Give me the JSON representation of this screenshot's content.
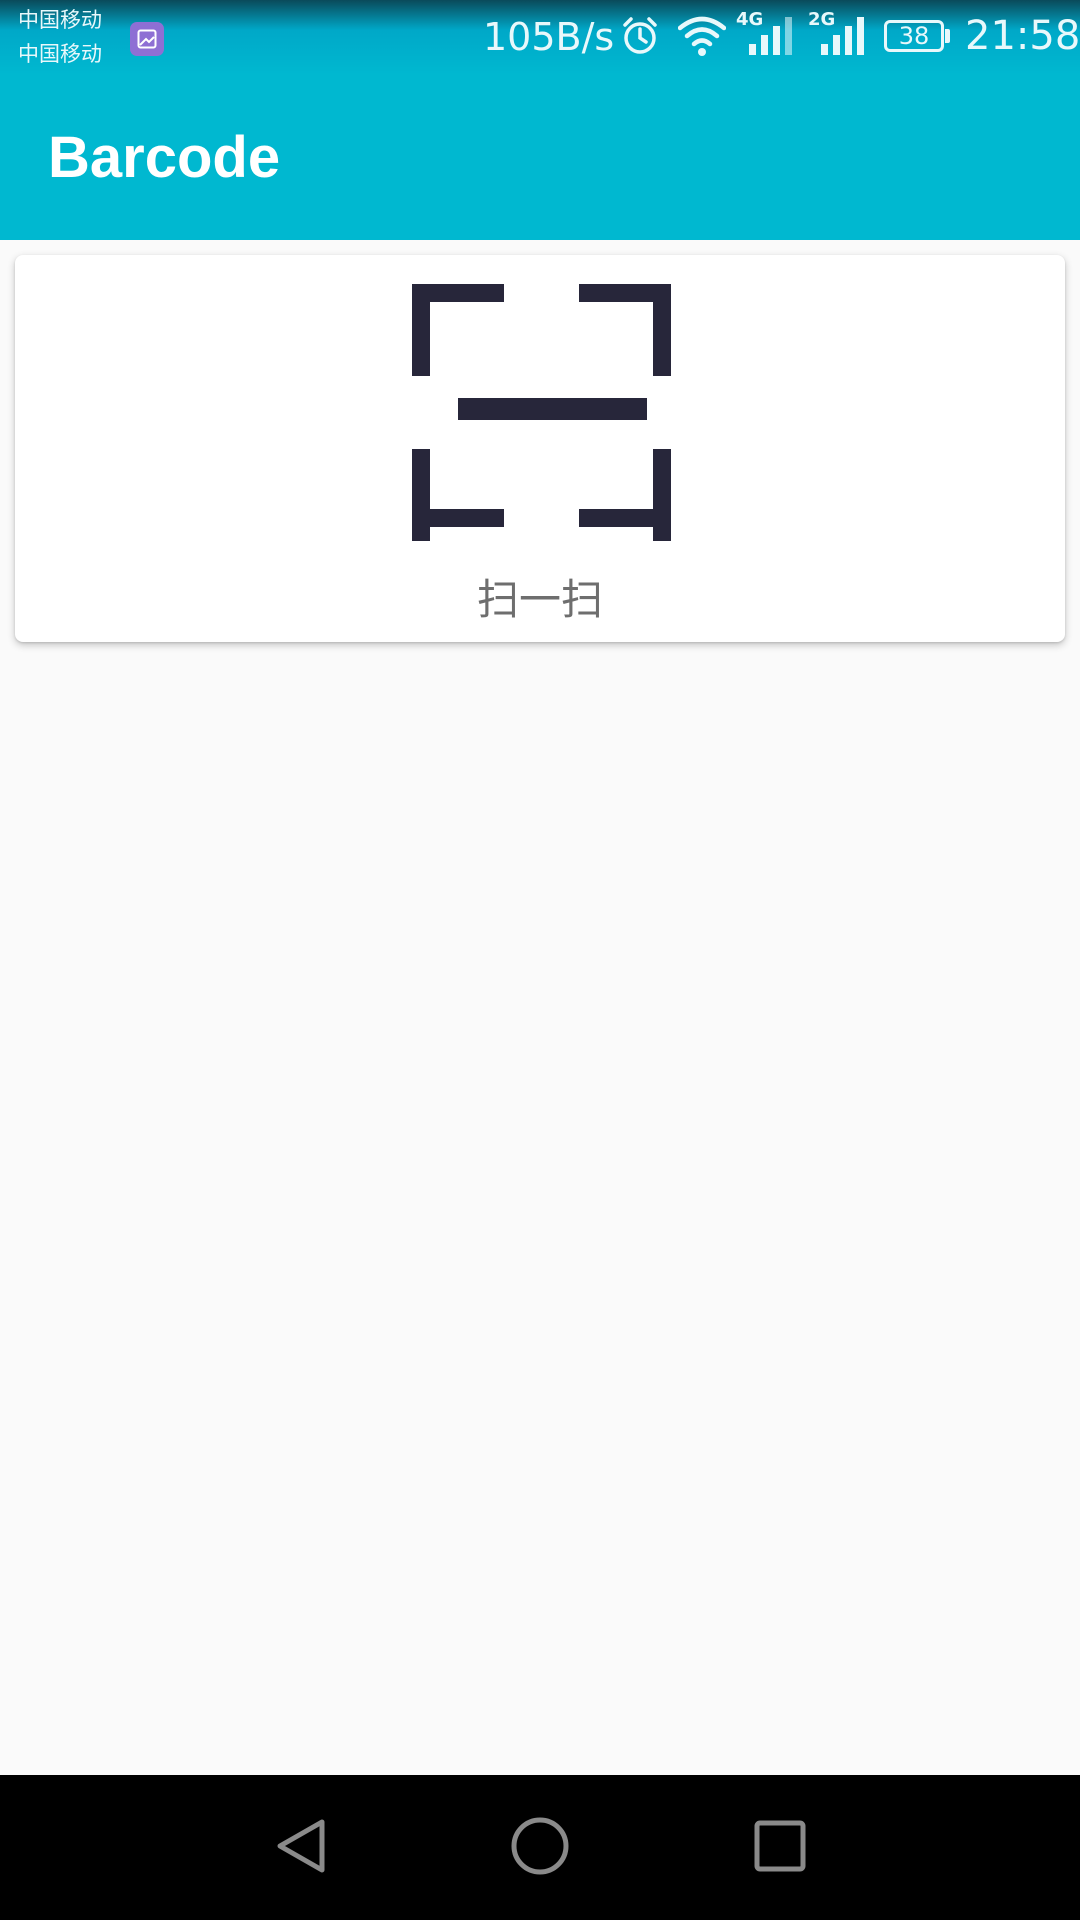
{
  "status_bar": {
    "carrier_1": "中国移动",
    "carrier_2": "中国移动",
    "net_speed": "105B/s",
    "network_1": "4G",
    "network_2": "2G",
    "battery_level": "38",
    "time": "21:58",
    "icons": [
      "image-notification-icon",
      "alarm-icon",
      "wifi-icon",
      "signal-4g-icon",
      "signal-2g-icon",
      "battery-icon"
    ]
  },
  "app_bar": {
    "title": "Barcode",
    "color": "#00b8d0"
  },
  "scan_card": {
    "icon": "scan-icon",
    "label": "扫一扫",
    "icon_color": "#27263a"
  },
  "nav_bar": {
    "buttons": [
      "back-icon",
      "home-icon",
      "recent-apps-icon"
    ]
  }
}
